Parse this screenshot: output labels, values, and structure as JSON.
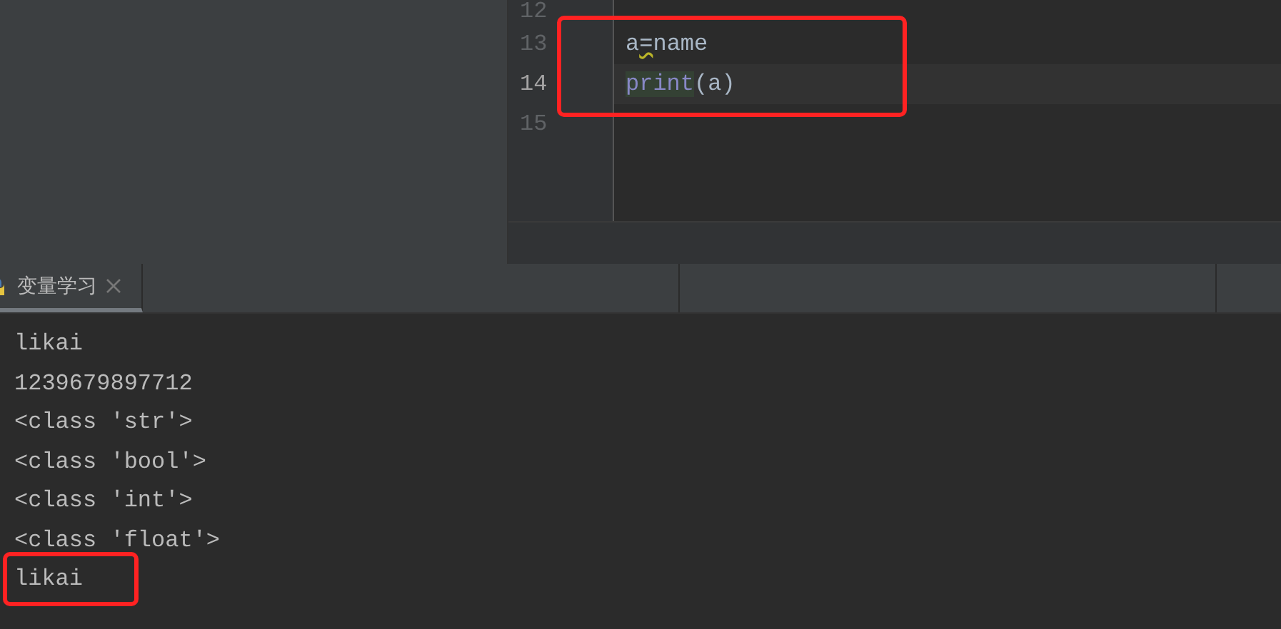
{
  "editor": {
    "lines": [
      {
        "number": "12",
        "current": false
      },
      {
        "number": "13",
        "current": false,
        "tokens": [
          {
            "text": "a",
            "kind": "plain"
          },
          {
            "text": "=",
            "kind": "warning"
          },
          {
            "text": "name",
            "kind": "plain"
          }
        ]
      },
      {
        "number": "14",
        "current": true,
        "tokens": [
          {
            "text": "print",
            "kind": "builtin"
          },
          {
            "text": "(a)",
            "kind": "plain"
          }
        ]
      },
      {
        "number": "15",
        "current": false
      }
    ]
  },
  "run_tab": {
    "label": "变量学习",
    "selected": true
  },
  "console": {
    "lines": [
      "likai",
      "1239679897712",
      "<class 'str'>",
      "<class 'bool'>",
      "<class 'int'>",
      "<class 'float'>",
      "likai"
    ]
  }
}
